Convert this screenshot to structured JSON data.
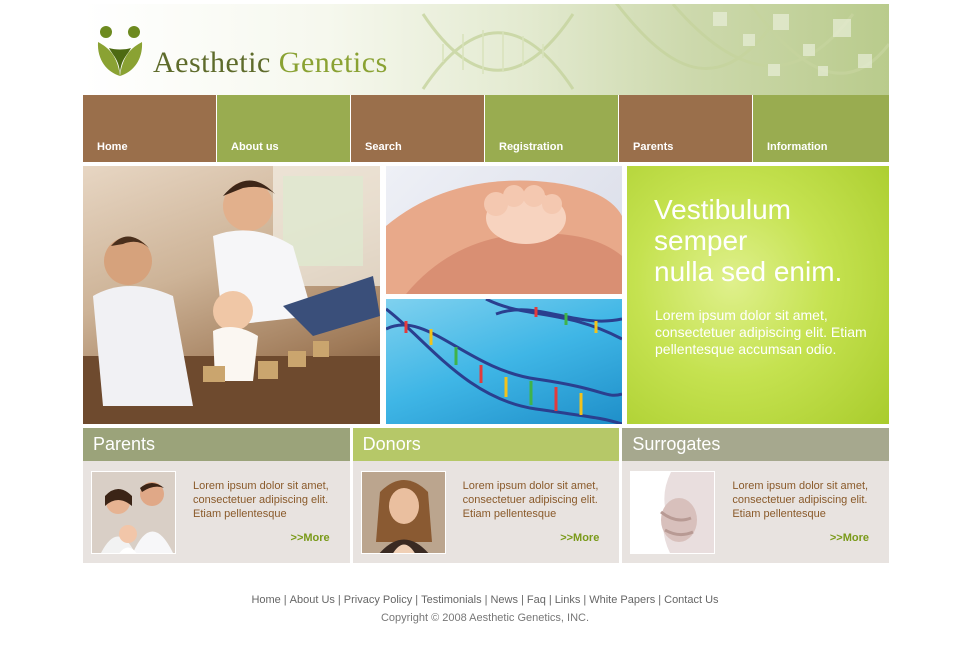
{
  "brand": {
    "logo_text_1": "Aesthetic",
    "logo_text_2": "Genetics",
    "logo_icon": "two-figures-heart-icon",
    "colors": {
      "brown": "#9a6f4b",
      "green": "#99ac50",
      "lime": "#b6c868",
      "promo": "#c5e250"
    }
  },
  "nav": {
    "items": [
      {
        "label": "Home"
      },
      {
        "label": "About us"
      },
      {
        "label": "Search"
      },
      {
        "label": "Registration"
      },
      {
        "label": "Parents"
      },
      {
        "label": "Information"
      }
    ]
  },
  "promo": {
    "title_lines": [
      "Vestibulum",
      "semper",
      "nulla sed enim."
    ],
    "text": "Lorem ipsum dolor sit amet, consectetuer adipiscing elit. Etiam pellentesque accumsan odio."
  },
  "boxes": [
    {
      "title": "Parents",
      "text": "Lorem ipsum dolor sit amet, consectetuer adipiscing elit. Etiam pellentesque",
      "more": ">>More"
    },
    {
      "title": "Donors",
      "text": "Lorem ipsum dolor sit amet, consectetuer adipiscing elit. Etiam pellentesque",
      "more": ">>More"
    },
    {
      "title": "Surrogates",
      "text": "Lorem ipsum dolor sit amet, consectetuer adipiscing elit. Etiam pellentesque",
      "more": ">>More"
    }
  ],
  "footer": {
    "links": [
      "Home",
      "About Us",
      "Privacy Policy",
      "Testimonials",
      "News",
      "Faq",
      "Links",
      "White Papers",
      "Contact Us"
    ],
    "separator": "|",
    "copyright": "Copyright © 2008 Aesthetic Genetics, INC."
  }
}
